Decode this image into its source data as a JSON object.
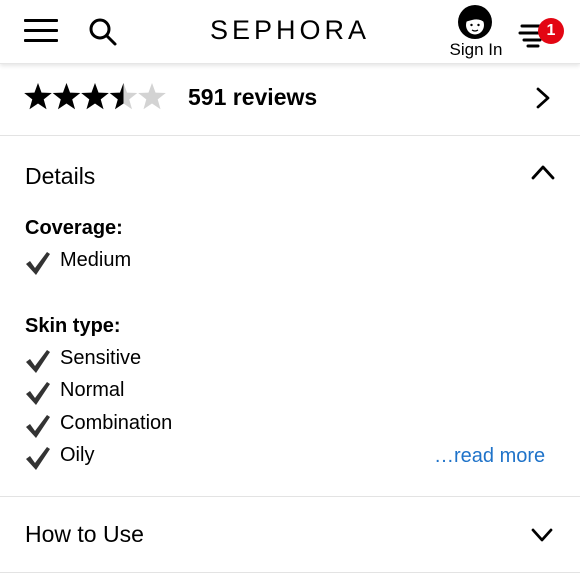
{
  "header": {
    "brand": "SEPHORA",
    "sign_in_label": "Sign In",
    "basket_count": "1",
    "icons": [
      "hamburger-menu-icon",
      "search-icon",
      "account-avatar-icon",
      "basket-icon"
    ],
    "badge_color": "#e30613"
  },
  "reviews": {
    "rating": 3.5,
    "max_rating": 5,
    "count_text": "591 reviews"
  },
  "details": {
    "title": "Details",
    "expanded": true,
    "coverage_label": "Coverage:",
    "coverage": [
      "Medium"
    ],
    "skin_type_label": "Skin type:",
    "skin_types": [
      "Sensitive",
      "Normal",
      "Combination",
      "Oily"
    ],
    "read_more": "…read more",
    "link_color": "#1f73c9"
  },
  "how_to_use": {
    "title": "How to Use",
    "expanded": false
  }
}
